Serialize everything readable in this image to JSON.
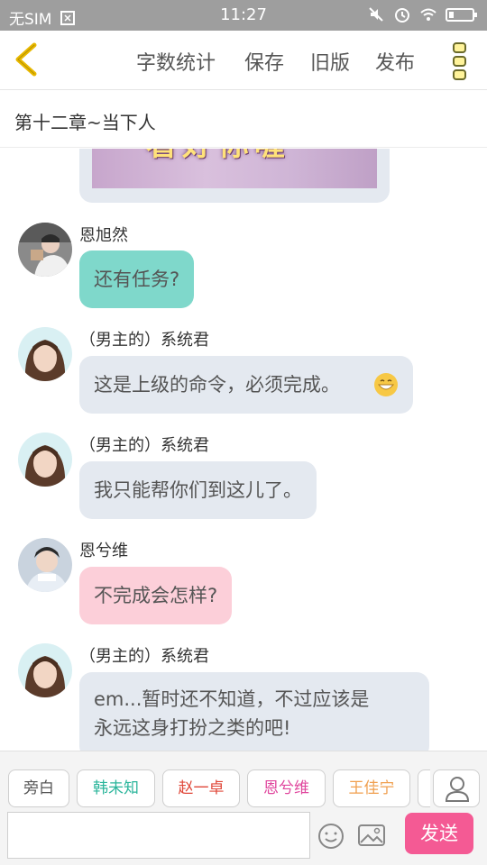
{
  "status_bar": {
    "carrier": "无SIM",
    "time": "11:27"
  },
  "top_bar": {
    "word_count": "字数统计",
    "save": "保存",
    "old_version": "旧版",
    "publish": "发布"
  },
  "chapter": {
    "title": "第十二章~当下人"
  },
  "image_message": {
    "overlay_text": "看好你喔"
  },
  "messages": [
    {
      "name": "恩旭然",
      "text": "还有任务?",
      "bubble_color": "#7fd8cb"
    },
    {
      "name": "（男主的）系统君",
      "text": "这是上级的命令，必须完成。",
      "bubble_color": "#e4e9f0",
      "emoji": "grin"
    },
    {
      "name": "（男主的）系统君",
      "text": "我只能帮你们到这儿了。",
      "bubble_color": "#e4e9f0"
    },
    {
      "name": "恩兮维",
      "text": "不完成会怎样?",
      "bubble_color": "#fccfd9"
    },
    {
      "name": "（男主的）系统君",
      "lines": [
        "em...暂时还不知道，不过应该是",
        "永远这身打扮之类的吧!"
      ],
      "bubble_color": "#e4e9f0"
    }
  ],
  "characters": [
    {
      "label": "旁白",
      "color": "#555555"
    },
    {
      "label": "韩未知",
      "color": "#2bb59b"
    },
    {
      "label": "赵一卓",
      "color": "#e0483a"
    },
    {
      "label": "恩兮维",
      "color": "#e0479e"
    },
    {
      "label": "王佳宁",
      "color": "#f0a050"
    }
  ],
  "input": {
    "value": "",
    "send": "发送"
  },
  "colors": {
    "accent_back": "#e8b800",
    "send_button": "#f45a94",
    "status_bar": "#9e9e9e"
  },
  "icons": [
    "back-arrow-icon",
    "more-dots-icon",
    "person-icon",
    "emoji-icon",
    "image-icon",
    "mute-icon",
    "alarm-icon",
    "wifi-icon",
    "battery-icon"
  ]
}
